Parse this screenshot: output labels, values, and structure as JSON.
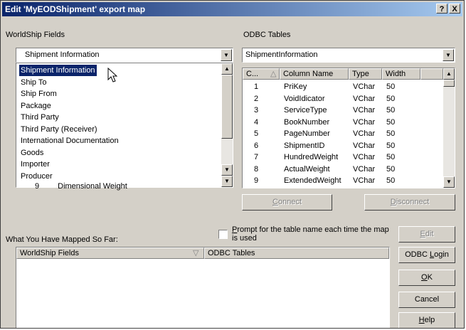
{
  "window": {
    "title": "Edit 'MyEODShipment' export map",
    "help_btn": "?",
    "close_btn": "X"
  },
  "left": {
    "label": "WorldShip Fields",
    "combo_value": "Shipment Information",
    "list": [
      "Shipment Information",
      "Ship To",
      "Ship From",
      "Package",
      "Third Party",
      "Third Party (Receiver)",
      "International Documentation",
      "Goods",
      "Importer",
      "Producer"
    ],
    "partial_row": {
      "num": "9",
      "name": "Dimensional Weight"
    }
  },
  "right": {
    "label": "ODBC Tables",
    "combo_value": "ShipmentInformation",
    "headers": [
      "C...",
      "Column Name",
      "Type",
      "Width"
    ],
    "rows": [
      [
        "1",
        "PriKey",
        "VChar",
        "50"
      ],
      [
        "2",
        "VoidIdicator",
        "VChar",
        "50"
      ],
      [
        "3",
        "ServiceType",
        "VChar",
        "50"
      ],
      [
        "4",
        "BookNumber",
        "VChar",
        "50"
      ],
      [
        "5",
        "PageNumber",
        "VChar",
        "50"
      ],
      [
        "6",
        "ShipmentID",
        "VChar",
        "50"
      ],
      [
        "7",
        "HundredWeight",
        "VChar",
        "50"
      ],
      [
        "8",
        "ActualWeight",
        "VChar",
        "50"
      ],
      [
        "9",
        "ExtendedWeight",
        "VChar",
        "50"
      ]
    ]
  },
  "buttons": {
    "connect_pre": "",
    "connect_ul": "C",
    "connect_post": "onnect",
    "disconnect_pre": "",
    "disconnect_ul": "D",
    "disconnect_post": "isconnect",
    "edit_pre": "",
    "edit_ul": "E",
    "edit_post": "dit",
    "odbc_pre": "ODBC ",
    "odbc_ul": "L",
    "odbc_post": "ogin",
    "ok_pre": "",
    "ok_ul": "O",
    "ok_post": "K",
    "cancel": "Cancel",
    "help_pre": "",
    "help_ul": "H",
    "help_post": "elp"
  },
  "mapped": {
    "label": "What You Have Mapped So Far:",
    "col1": "WorldShip Fields",
    "col2": "ODBC Tables",
    "prompt_line1_pre": "",
    "prompt_line1_ul": "P",
    "prompt_line1_post": "rompt for the table name each time the map",
    "prompt_line2": "is used"
  },
  "icons": {
    "dropdown": "▼",
    "up": "▲",
    "down": "▼",
    "sort": "△",
    "sort_desc": "▽"
  }
}
